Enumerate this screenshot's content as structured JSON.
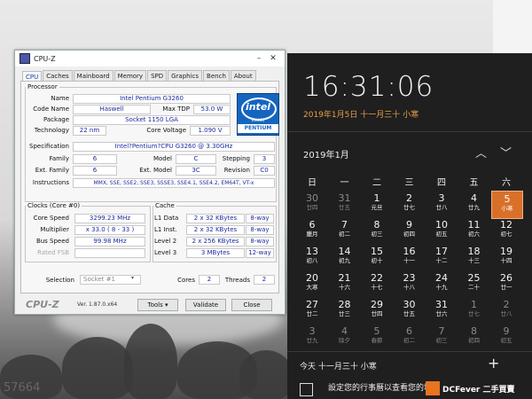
{
  "watermark_text": "57664",
  "cpuz": {
    "title": "CPU-Z",
    "tabs": [
      "CPU",
      "Caches",
      "Mainboard",
      "Memory",
      "SPD",
      "Graphics",
      "Bench",
      "About"
    ],
    "processor": {
      "legend": "Processor",
      "name_label": "Name",
      "name": "Intel Pentium G3260",
      "codename_label": "Code Name",
      "codename": "Haswell",
      "maxtdp_label": "Max TDP",
      "maxtdp": "53.0 W",
      "package_label": "Package",
      "package": "Socket 1150 LGA",
      "technology_label": "Technology",
      "technology": "22 nm",
      "corevoltage_label": "Core Voltage",
      "corevoltage": "1.090 V",
      "spec_label": "Specification",
      "spec": "Intel?Pentium?CPU G3260 @ 3.30GHz",
      "family_label": "Family",
      "family": "6",
      "model_label": "Model",
      "model": "C",
      "stepping_label": "Stepping",
      "stepping": "3",
      "extfamily_label": "Ext. Family",
      "extfamily": "6",
      "extmodel_label": "Ext. Model",
      "extmodel": "3C",
      "revision_label": "Revision",
      "revision": "C0",
      "instructions_label": "Instructions",
      "instructions": "MMX, SSE, SSE2, SSE3, SSSE3, SSE4.1, SSE4.2, EM64T, VT-x",
      "logo_line1": "intel",
      "logo_line2": "inside",
      "logo_line3": "PENTIUM"
    },
    "clocks": {
      "legend": "Clocks (Core #0)",
      "corespeed_label": "Core Speed",
      "corespeed": "3299.23 MHz",
      "multiplier_label": "Multiplier",
      "multiplier": "x 33.0 ( 8 - 33 )",
      "busspeed_label": "Bus Speed",
      "busspeed": "99.98 MHz",
      "ratedfsb_label": "Rated FSB",
      "ratedfsb": ""
    },
    "cache": {
      "legend": "Cache",
      "l1data_label": "L1 Data",
      "l1data": "2 x 32 KBytes",
      "l1data_way": "8-way",
      "l1inst_label": "L1 Inst.",
      "l1inst": "2 x 32 KBytes",
      "l1inst_way": "8-way",
      "level2_label": "Level 2",
      "level2": "2 x 256 KBytes",
      "level2_way": "8-way",
      "level3_label": "Level 3",
      "level3": "3 MBytes",
      "level3_way": "12-way"
    },
    "selection_label": "Selection",
    "selection": "Socket #1",
    "cores_label": "Cores",
    "cores": "2",
    "threads_label": "Threads",
    "threads": "2",
    "footer_logo": "CPU-Z",
    "version": "Ver. 1.87.0.x64",
    "tools_button": "Tools",
    "validate_button": "Validate",
    "close_button": "Close"
  },
  "flyout": {
    "time": "16:31:06",
    "date": "2019年1月5日 十一月三十 小寒",
    "month_label": "2019年1月",
    "weekdays": [
      "日",
      "一",
      "二",
      "三",
      "四",
      "五",
      "六"
    ],
    "days": [
      {
        "n": "30",
        "s": "廿四",
        "t": "other"
      },
      {
        "n": "31",
        "s": "廿五",
        "t": "other"
      },
      {
        "n": "1",
        "s": "元旦",
        "t": "cur"
      },
      {
        "n": "2",
        "s": "廿七",
        "t": "cur"
      },
      {
        "n": "3",
        "s": "廿八",
        "t": "cur"
      },
      {
        "n": "4",
        "s": "廿九",
        "t": "cur"
      },
      {
        "n": "5",
        "s": "小寒",
        "t": "today"
      },
      {
        "n": "6",
        "s": "臘月",
        "t": "cur"
      },
      {
        "n": "7",
        "s": "初二",
        "t": "cur"
      },
      {
        "n": "8",
        "s": "初三",
        "t": "cur"
      },
      {
        "n": "9",
        "s": "初四",
        "t": "cur"
      },
      {
        "n": "10",
        "s": "初五",
        "t": "cur"
      },
      {
        "n": "11",
        "s": "初六",
        "t": "cur"
      },
      {
        "n": "12",
        "s": "初七",
        "t": "cur"
      },
      {
        "n": "13",
        "s": "初八",
        "t": "cur"
      },
      {
        "n": "14",
        "s": "初九",
        "t": "cur"
      },
      {
        "n": "15",
        "s": "初十",
        "t": "cur"
      },
      {
        "n": "16",
        "s": "十一",
        "t": "cur"
      },
      {
        "n": "17",
        "s": "十二",
        "t": "cur"
      },
      {
        "n": "18",
        "s": "十三",
        "t": "cur"
      },
      {
        "n": "19",
        "s": "十四",
        "t": "cur"
      },
      {
        "n": "20",
        "s": "大寒",
        "t": "cur"
      },
      {
        "n": "21",
        "s": "十六",
        "t": "cur"
      },
      {
        "n": "22",
        "s": "十七",
        "t": "cur"
      },
      {
        "n": "23",
        "s": "十八",
        "t": "cur"
      },
      {
        "n": "24",
        "s": "十九",
        "t": "cur"
      },
      {
        "n": "25",
        "s": "二十",
        "t": "cur"
      },
      {
        "n": "26",
        "s": "廿一",
        "t": "cur"
      },
      {
        "n": "27",
        "s": "廿二",
        "t": "cur"
      },
      {
        "n": "28",
        "s": "廿三",
        "t": "cur"
      },
      {
        "n": "29",
        "s": "廿四",
        "t": "cur"
      },
      {
        "n": "30",
        "s": "廿五",
        "t": "cur"
      },
      {
        "n": "31",
        "s": "廿六",
        "t": "cur"
      },
      {
        "n": "1",
        "s": "廿七",
        "t": "other"
      },
      {
        "n": "2",
        "s": "廿八",
        "t": "other"
      },
      {
        "n": "3",
        "s": "廿九",
        "t": "other"
      },
      {
        "n": "4",
        "s": "除夕",
        "t": "other"
      },
      {
        "n": "5",
        "s": "春節",
        "t": "other"
      },
      {
        "n": "6",
        "s": "初二",
        "t": "other"
      },
      {
        "n": "7",
        "s": "初三",
        "t": "other"
      },
      {
        "n": "8",
        "s": "初四",
        "t": "other"
      },
      {
        "n": "9",
        "s": "初五",
        "t": "other"
      }
    ],
    "event_header": "今天 十一月三十 小寒",
    "event_note": "設定您的行事曆以查看您的地方"
  },
  "site_badge": "DCFever 二手買賣"
}
